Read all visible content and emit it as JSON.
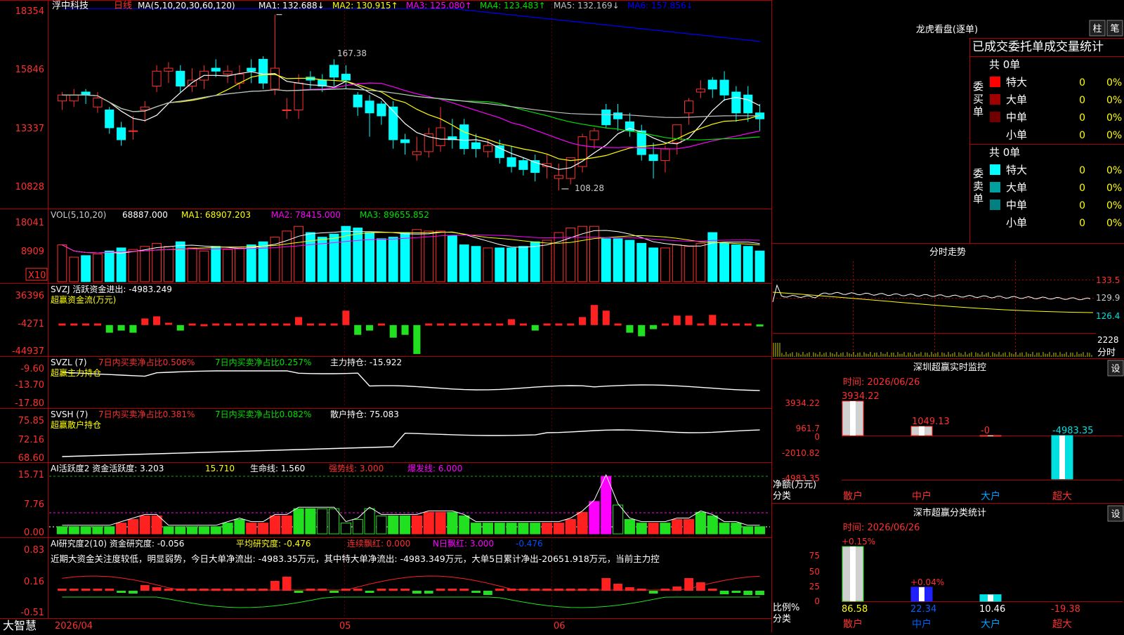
{
  "stock": {
    "name": "浮中科技",
    "period": "日线",
    "ma_legend": "MA(5,10,20,30,60,120)",
    "ma_values": [
      {
        "label": "MA1:",
        "value": "132.688",
        "arrow": "↓",
        "color": "#ffffff"
      },
      {
        "label": "MA2:",
        "value": "130.915",
        "arrow": "↑",
        "color": "#ffff00"
      },
      {
        "label": "MA3:",
        "value": "125.080",
        "arrow": "↑",
        "color": "#ff00ff"
      },
      {
        "label": "MA4:",
        "value": "123.483",
        "arrow": "↑",
        "color": "#00e000"
      },
      {
        "label": "MA5:",
        "value": "132.169",
        "arrow": "↓",
        "color": "#c0c0c0"
      },
      {
        "label": "MA6:",
        "value": "157.856",
        "arrow": "↓",
        "color": "#0000ff"
      }
    ],
    "price_axis": [
      "18354",
      "15846",
      "13337",
      "10828"
    ],
    "high_mark": "167.38",
    "low_mark": "108.28"
  },
  "volume": {
    "header": "VOL(5,10,20)",
    "value": "68887.000",
    "ma1": "MA1: 68907.203",
    "ma2": "MA2: 78415.000",
    "ma3": "MA3: 89655.852",
    "axis": [
      "18041",
      "8909"
    ],
    "unit": "X10"
  },
  "svzj": {
    "header": "SVZJ  活跃资金进出: -4983.249",
    "sub": "超赢资金流(万元)",
    "axis": [
      "36396",
      "-4271",
      "-44937"
    ]
  },
  "svzl": {
    "header_a": "SVZL (7)",
    "header_b": "7日内买卖净占比0.506%",
    "header_c": "7日内买卖净占比0.257%",
    "header_d": "主力持仓: -15.922",
    "sub": "超赢主力持仓",
    "axis": [
      "-9.60",
      "-13.70",
      "-17.80"
    ]
  },
  "svsh": {
    "header_a": "SVSH (7)",
    "header_b": "7日内买卖净占比0.381%",
    "header_c": "7日内买卖净占比0.082%",
    "header_d": "散户持仓: 75.083",
    "sub": "超赢散户持仓",
    "axis": [
      "75.85",
      "72.16",
      "68.60"
    ]
  },
  "ai1": {
    "header_a": "AI活跃度2 资金活跃度: 3.203",
    "header_b": "15.710",
    "header_c": "生命线: 1.560",
    "header_d": "强势线: 3.000",
    "header_e": "爆发线: 6.000",
    "axis": [
      "15.71",
      "7.76",
      "0.00"
    ]
  },
  "ai2": {
    "header_a": "AI研究度2(10) 资金研究度: -0.056",
    "header_b": "平均研究度: -0.476",
    "header_c": "连续飘红: 0.000",
    "header_d": "N日飘红: 3.000",
    "header_e": "-0.476",
    "commentary": "近期大资金关注度较低，明显弱势，今日大单净流出: -4983.35万元，其中特大单净流出: -4983.349万元，大单5日累计净出-20651.918万元，当前主力控",
    "axis": [
      "0.83",
      "0.16",
      "-0.51"
    ]
  },
  "date_axis": [
    "2026/04",
    "05",
    "06"
  ],
  "brand": "大智慧",
  "right": {
    "lhb_title": "龙虎看盘(逐单)",
    "btn_zhu": "柱",
    "btn_bi": "笔",
    "tab_title": "已成交委托单成交量统计",
    "buy_label": "委买单",
    "sell_label": "委卖单",
    "buy_total": "共 0单",
    "sell_total": "共 0单",
    "buy_rows": [
      {
        "label": "特大",
        "count": "0",
        "pct": "0%",
        "color": "#ff0000"
      },
      {
        "label": "大单",
        "count": "0",
        "pct": "0%",
        "color": "#a00000"
      },
      {
        "label": "中单",
        "count": "0",
        "pct": "0%",
        "color": "#700000"
      },
      {
        "label": "小单",
        "count": "0",
        "pct": "0%",
        "color": "#000000"
      }
    ],
    "sell_rows": [
      {
        "label": "特大",
        "count": "0",
        "pct": "0%",
        "color": "#00ffff"
      },
      {
        "label": "大单",
        "count": "0",
        "pct": "0%",
        "color": "#00a0a0"
      },
      {
        "label": "中单",
        "count": "0",
        "pct": "0%",
        "color": "#008080"
      },
      {
        "label": "小单",
        "count": "0",
        "pct": "0%",
        "color": "#000000"
      }
    ],
    "intraday_title": "分时走势",
    "intraday_axis": [
      "133.5",
      "129.9",
      "126.4"
    ],
    "intraday_vol": "2228",
    "intraday_unit": "分时",
    "sz_title": "深圳超赢实时监控",
    "sz_btn": "设",
    "sz_time": "时间: 2026/06/26",
    "sz_axis": [
      "3934.22",
      "961.7",
      "0",
      "-2010.82",
      "-4983.35"
    ],
    "sz_axis_label": "净额(万元)",
    "sz_cat_label": "分类",
    "sz_bars": [
      {
        "cat": "散户",
        "label": "3934.22"
      },
      {
        "cat": "中户",
        "label": "1049.13"
      },
      {
        "cat": "大户",
        "label": "-0"
      },
      {
        "cat": "超大",
        "label": "-4983.35"
      }
    ],
    "cls_title": "深市超赢分类统计",
    "cls_btn": "设",
    "cls_time": "时间: 2026/06/26",
    "cls_axis": [
      "75",
      "50",
      "25",
      "0"
    ],
    "cls_axis_label": "比例%",
    "cls_cat_label": "分类",
    "cls_bars": [
      {
        "cat": "散户",
        "top": "+0.15%",
        "bottom": "86.58"
      },
      {
        "cat": "中户",
        "top": "+0.04%",
        "bottom": "22.34"
      },
      {
        "cat": "大户",
        "top": "",
        "bottom": "10.46"
      },
      {
        "cat": "超大",
        "top": "",
        "bottom": "-19.38"
      }
    ]
  },
  "chart_data": {
    "type": "bar",
    "title": "浮中科技 日线",
    "candles": {
      "open": [
        138,
        138,
        141,
        136,
        135,
        129,
        128,
        135,
        143,
        148,
        148,
        143,
        145,
        149,
        147,
        144,
        149,
        152,
        142,
        135,
        135,
        146,
        145,
        150,
        147,
        140,
        138,
        137,
        136,
        125,
        120,
        121,
        123,
        126,
        130,
        124,
        121,
        123,
        119,
        118,
        118,
        116,
        112,
        112,
        116,
        125,
        135,
        134,
        131,
        128,
        120,
        118,
        124,
        134,
        141,
        145,
        145,
        141,
        140,
        134
      ],
      "close": [
        140,
        140,
        140,
        139,
        129,
        125,
        128,
        136,
        148,
        149,
        143,
        145,
        148,
        148,
        148,
        147,
        148,
        144,
        149,
        135,
        144,
        145,
        143,
        146,
        145,
        136,
        134,
        133,
        125,
        124,
        121,
        127,
        129,
        125,
        122,
        122,
        123,
        119,
        116,
        115,
        114,
        117,
        113,
        119,
        126,
        128,
        130,
        132,
        128,
        120,
        118,
        122,
        130,
        138,
        142,
        142,
        140,
        134,
        134,
        132
      ],
      "high": [
        141,
        142,
        142,
        141,
        136,
        131,
        133,
        138,
        150,
        151,
        150,
        149,
        150,
        152,
        150,
        150,
        152,
        153,
        167,
        139,
        147,
        148,
        147,
        152,
        150,
        141,
        140,
        138,
        138,
        127,
        126,
        129,
        136,
        132,
        132,
        127,
        125,
        125,
        123,
        119,
        120,
        120,
        117,
        119,
        127,
        129,
        137,
        137,
        134,
        130,
        124,
        123,
        130,
        139,
        145,
        146,
        148,
        143,
        143,
        137
      ],
      "low": [
        135,
        136,
        137,
        134,
        127,
        123,
        125,
        131,
        141,
        144,
        141,
        141,
        142,
        146,
        144,
        142,
        144,
        142,
        140,
        132,
        132,
        142,
        141,
        143,
        142,
        133,
        126,
        130,
        122,
        120,
        118,
        119,
        121,
        122,
        120,
        119,
        119,
        117,
        114,
        113,
        111,
        112,
        108,
        110,
        114,
        122,
        129,
        128,
        126,
        118,
        112,
        114,
        120,
        130,
        139,
        139,
        138,
        131,
        131,
        128
      ]
    },
    "ma_series": [
      {
        "name": "MA1",
        "values": [
          132.688
        ]
      },
      {
        "name": "MA2",
        "values": [
          130.915
        ]
      },
      {
        "name": "MA3",
        "values": [
          125.08
        ]
      },
      {
        "name": "MA4",
        "values": [
          123.483
        ]
      },
      {
        "name": "MA5",
        "values": [
          132.169
        ]
      },
      {
        "name": "MA6",
        "values": [
          157.856
        ]
      }
    ],
    "volume": [
      12000,
      8000,
      8500,
      9000,
      10000,
      11000,
      10500,
      11500,
      12500,
      11500,
      13000,
      11000,
      10000,
      11500,
      10500,
      11000,
      12000,
      13000,
      14500,
      16500,
      18041,
      16000,
      14500,
      15500,
      18041,
      17500,
      16000,
      14000,
      14500,
      16000,
      17000,
      16500,
      16500,
      15000,
      12000,
      11500,
      11000,
      11000,
      11000,
      11500,
      13000,
      13500,
      16000,
      17500,
      18041,
      18041,
      14000,
      14000,
      13500,
      12500,
      11000,
      11000,
      12000,
      11500,
      12500,
      16000,
      12500,
      12000,
      11500,
      10000
    ],
    "svzj": [
      -3000,
      -3000,
      -3000,
      -3000,
      -15000,
      -12000,
      -15000,
      5000,
      8000,
      -2000,
      -12000,
      -3000,
      -4000,
      -3000,
      -3000,
      -3000,
      -3000,
      -3000,
      -3000,
      -3000,
      7000,
      -3000,
      -3000,
      -3000,
      16000,
      -18000,
      -12000,
      -3000,
      -22000,
      -18000,
      -44937,
      -3000,
      -3000,
      -3000,
      -3000,
      -3000,
      -3000,
      -3000,
      4000,
      -3000,
      -12000,
      -3000,
      -3000,
      -3000,
      7000,
      24000,
      16000,
      -3000,
      -15000,
      -20000,
      -10000,
      -3000,
      9000,
      9000,
      -3000,
      10000,
      -3000,
      -3000,
      -3000,
      -5000
    ]
  }
}
